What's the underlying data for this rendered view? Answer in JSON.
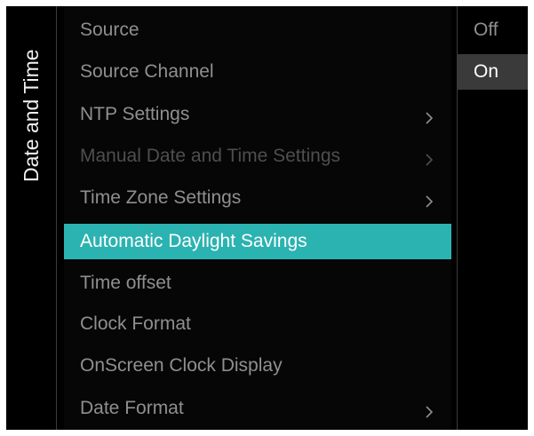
{
  "sidebar": {
    "title": "Date and Time"
  },
  "menu": {
    "items": [
      {
        "label": "Source",
        "has_submenu": false,
        "state": "normal"
      },
      {
        "label": "Source Channel",
        "has_submenu": false,
        "state": "normal"
      },
      {
        "label": "NTP Settings",
        "has_submenu": true,
        "state": "normal"
      },
      {
        "label": "Manual Date and Time Settings",
        "has_submenu": true,
        "state": "disabled"
      },
      {
        "label": "Time Zone Settings",
        "has_submenu": true,
        "state": "normal"
      },
      {
        "label": "Automatic Daylight Savings",
        "has_submenu": false,
        "state": "selected"
      },
      {
        "label": "Time offset",
        "has_submenu": false,
        "state": "normal"
      },
      {
        "label": "Clock Format",
        "has_submenu": false,
        "state": "normal"
      },
      {
        "label": "OnScreen Clock Display",
        "has_submenu": false,
        "state": "normal"
      },
      {
        "label": "Date Format",
        "has_submenu": true,
        "state": "normal"
      }
    ]
  },
  "options": {
    "items": [
      {
        "label": "Off",
        "state": "normal"
      },
      {
        "label": "On",
        "state": "active"
      }
    ]
  },
  "colors": {
    "background": "#000000",
    "selected_highlight": "#2bb3b1",
    "active_option_bg": "#3a3a3a",
    "text_normal": "#8f8f8f",
    "text_disabled": "#4e4e4e",
    "text_bright": "#ffffff"
  },
  "icons": {
    "submenu": "chevron-right-icon"
  }
}
